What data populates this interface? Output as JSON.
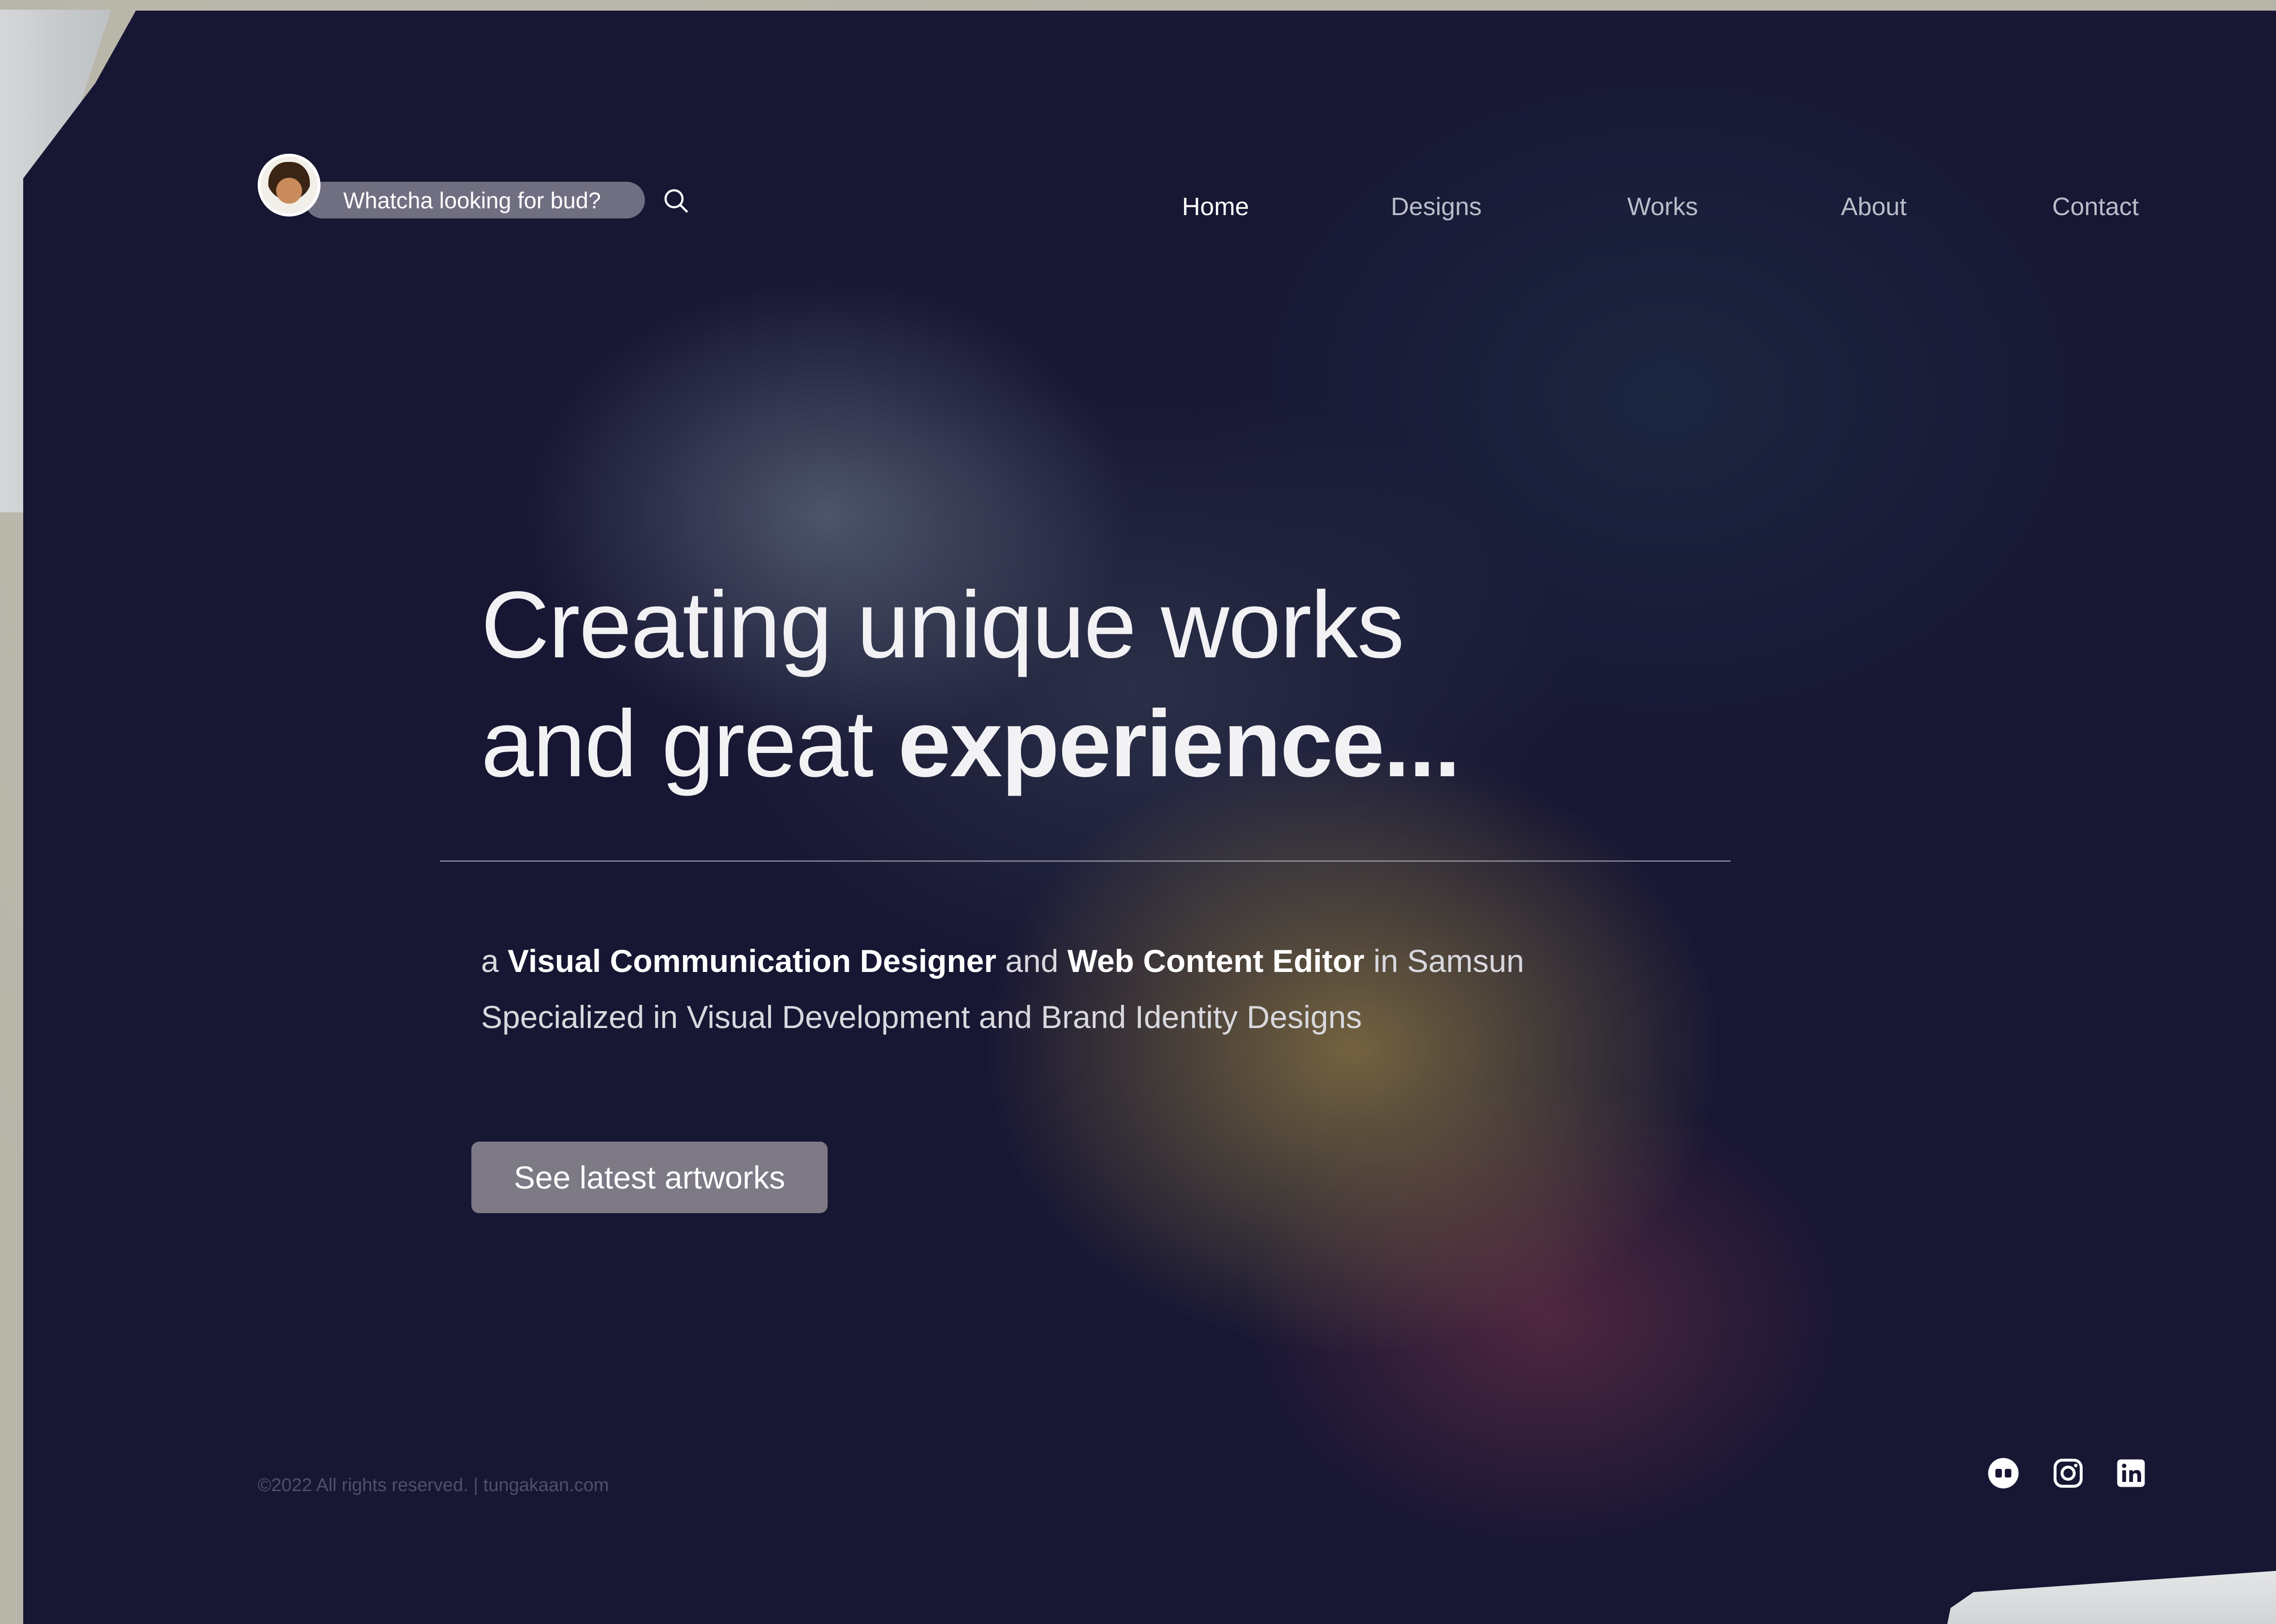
{
  "header": {
    "search": {
      "placeholder": "Whatcha looking for bud?"
    },
    "nav": [
      {
        "label": "Home",
        "active": true
      },
      {
        "label": "Designs",
        "active": false
      },
      {
        "label": "Works",
        "active": false
      },
      {
        "label": "About",
        "active": false
      },
      {
        "label": "Contact",
        "active": false
      }
    ]
  },
  "hero": {
    "headline_line1": "Creating unique works",
    "headline_line2_plain": "and great ",
    "headline_line2_bold": "experience...",
    "tagline_a": "a ",
    "tagline_role1": "Visual Communication Designer",
    "tagline_and": " and ",
    "tagline_role2": "Web Content Editor",
    "tagline_location": " in Samsun",
    "tagline_line2": "Specialized in Visual Development and Brand Identity Designs",
    "cta_label": "See latest artworks"
  },
  "footer": {
    "copyright": "©2022 All rights reserved. | tungakaan.com",
    "social_icons": [
      "behance-icon",
      "instagram-icon",
      "linkedin-icon"
    ]
  },
  "colors": {
    "background": "#171633",
    "text": "#f2f2f4",
    "nav_inactive": "#b9bdc8"
  }
}
